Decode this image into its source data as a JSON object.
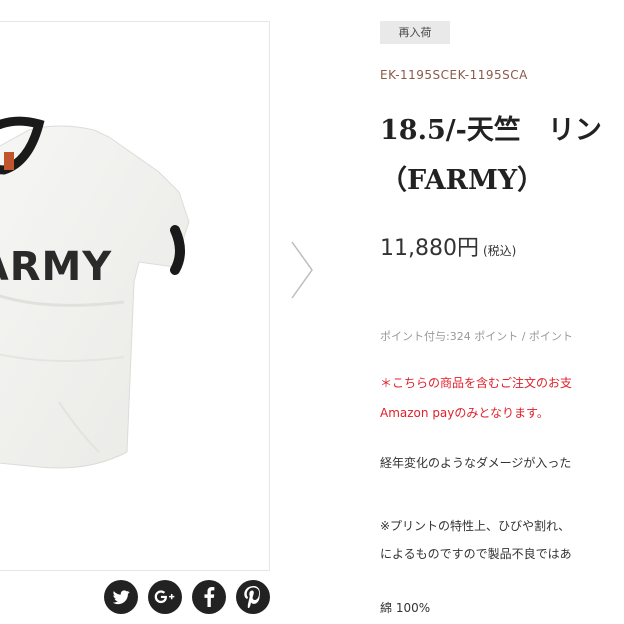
{
  "badge": {
    "restock": "再入荷"
  },
  "product": {
    "sku": "EK-1195SCEK-1195SCA",
    "title_line1": "18.5/-天竺　リン",
    "title_line2": "（FARMY）",
    "price": "11,880円",
    "tax_note": "(税込)",
    "shirt_print": "FARMY",
    "points": "ポイント付与:324 ポイント / ポイント",
    "notice_line1": "＊こちらの商品を含むご注文のお支",
    "notice_line2": "Amazon payのみとなります。",
    "desc_line1": "経年変化のようなダメージが入った",
    "desc_line2": "※プリントの特性上、ひびや割れ、",
    "desc_line3": "によるものですので製品不良ではあ",
    "material": "綿 100%"
  },
  "share": {
    "icons": [
      "twitter-icon",
      "google-plus-icon",
      "facebook-icon",
      "pinterest-icon"
    ]
  },
  "colors": {
    "notice_red": "#e0202a",
    "sku_brown": "#8a5a4a",
    "badge_bg": "#e9e9e9",
    "share_bg": "#222222"
  }
}
